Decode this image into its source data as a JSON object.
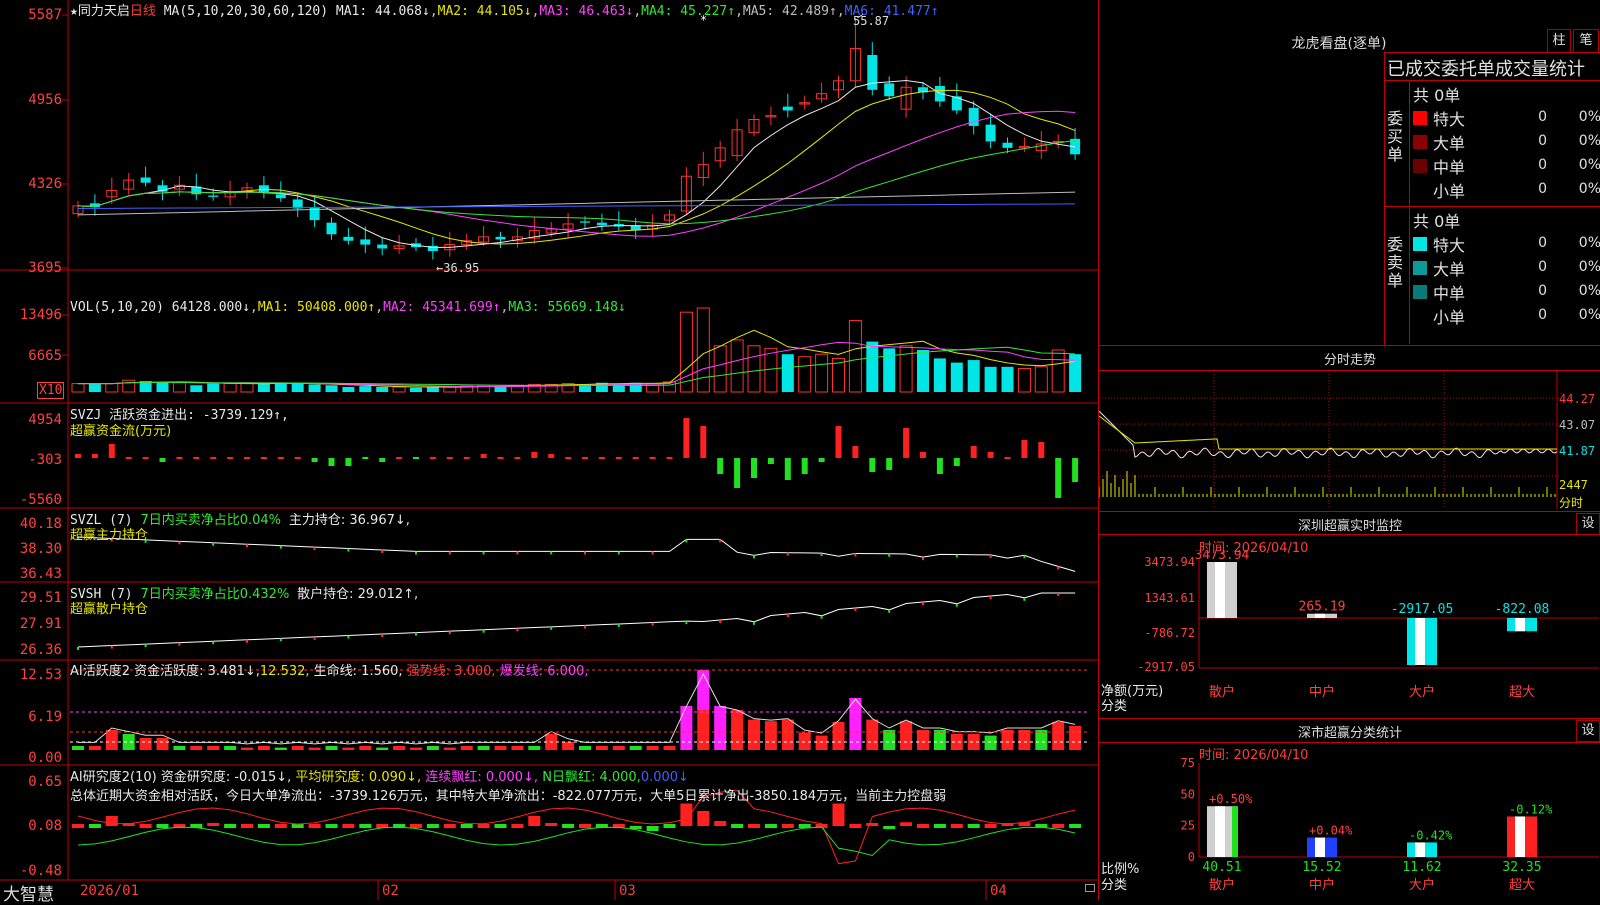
{
  "main": {
    "star": "★",
    "stock_name": "同力天启",
    "period": "日线",
    "ma_label": "MA(5,10,20,30,60,120)",
    "ma": [
      {
        "label": "MA1: 44.068↓",
        "color": "#e8e8e8"
      },
      {
        "label": "MA2: 44.105↓",
        "color": "#e6e600"
      },
      {
        "label": "MA3: 46.463↓",
        "color": "#ff40ff"
      },
      {
        "label": "MA4: 45.227↑",
        "color": "#35e635"
      },
      {
        "label": "MA5: 42.489↑",
        "color": "#bdbdbd"
      },
      {
        "label": "MA6: 41.477↑",
        "color": "#4060ff"
      }
    ],
    "y_ticks": [
      "5587",
      "4956",
      "4326",
      "3695"
    ],
    "high_note": "55.87",
    "low_note": "←36.95"
  },
  "vol": {
    "label": "VOL(5,10,20)",
    "value": "64128.000↓",
    "ma1": "MA1: 50408.000↑",
    "ma2": "MA2: 45341.699↑",
    "ma3": "MA3: 55669.148↓",
    "y_ticks": [
      "13496",
      "6665"
    ],
    "unit": "X10"
  },
  "svzj": {
    "label": "SVZJ  活跃资金进出: -3739.129↑,",
    "sub": "超赢资金流(万元)",
    "y_ticks": [
      "4954",
      "-303",
      "-5560"
    ]
  },
  "svzl": {
    "label": "SVZL (7)",
    "pct": "7日内买卖净占比0.04%",
    "main": "主力持仓: 36.967↓,",
    "sub": "超赢主力持仓",
    "y_ticks": [
      "40.18",
      "38.30",
      "36.43"
    ]
  },
  "svsh": {
    "label": "SVSH (7)",
    "pct": "7日内买卖净占比0.432%",
    "main": "散户持仓: 29.012↑,",
    "sub": "超赢散户持仓",
    "y_ticks": [
      "29.51",
      "27.91",
      "26.36"
    ]
  },
  "ai1": {
    "label": "AI活跃度2 资金活跃度: 3.481↓,",
    "v2": "12.532,",
    "v3": "生命线: 1.560,",
    "v4": "强势线: 3.000,",
    "v5": "爆发线: 6.000,",
    "y_ticks": [
      "12.53",
      "6.19",
      "0.00"
    ]
  },
  "ai2": {
    "label": "AI研究度2(10) 资金研究度: -0.015↓,",
    "v2": "平均研究度: 0.090↓,",
    "v3": "连续飘红: 0.000↓,",
    "v4": "N日飘红: 4.000,",
    "v5": "0.000↓",
    "summary": "总体近期大资金相对活跃，今日大单净流出：-3739.126万元，其中特大单净流出：-822.077万元，大单5日累计净出-3850.184万元，当前主力控盘弱",
    "y_ticks": [
      "0.65",
      "0.08",
      "-0.48"
    ]
  },
  "xaxis": {
    "brand": "大智慧",
    "labels": [
      "2026/01",
      "02",
      "03",
      "04"
    ]
  },
  "lhb": {
    "title": "龙虎看盘(逐单)",
    "btn1": "柱",
    "btn2": "笔",
    "header": "已成交委托单成交量统计",
    "buy": {
      "side": "委买单",
      "total": "共 0单",
      "rows": [
        {
          "name": "特大",
          "v": "0",
          "p": "0%",
          "c": "#ff0000"
        },
        {
          "name": "大单",
          "v": "0",
          "p": "0%",
          "c": "#8b0000"
        },
        {
          "name": "中单",
          "v": "0",
          "p": "0%",
          "c": "#6b0000"
        },
        {
          "name": "小单",
          "v": "0",
          "p": "0%",
          "c": "#000000"
        }
      ]
    },
    "sell": {
      "side": "委卖单",
      "total": "共 0单",
      "rows": [
        {
          "name": "特大",
          "v": "0",
          "p": "0%",
          "c": "#00e5e5"
        },
        {
          "name": "大单",
          "v": "0",
          "p": "0%",
          "c": "#0a9a9a"
        },
        {
          "name": "中单",
          "v": "0",
          "p": "0%",
          "c": "#087a7a"
        },
        {
          "name": "小单",
          "v": "0",
          "p": "0%",
          "c": "#000000"
        }
      ]
    }
  },
  "fs": {
    "title": "分时走势",
    "y_ticks": [
      "44.27",
      "43.07",
      "41.87"
    ],
    "vol_tick": "2447",
    "vol_unit": "分时"
  },
  "szjk": {
    "title": "深圳超赢实时监控",
    "btn": "设",
    "time": "时间: 2026/04/10",
    "y_ticks": [
      "3473.94",
      "1343.61",
      "-786.72",
      "-2917.05"
    ],
    "unit": "净额(万元)",
    "cls": "分类",
    "bars": [
      {
        "name": "散户",
        "value": "3473.94"
      },
      {
        "name": "中户",
        "value": "265.19"
      },
      {
        "name": "大户",
        "value": "-2917.05"
      },
      {
        "name": "超大",
        "value": "-822.08"
      }
    ]
  },
  "szfl": {
    "title": "深市超赢分类统计",
    "btn": "设",
    "time": "时间: 2026/04/10",
    "y_ticks": [
      "75",
      "50",
      "25",
      "0"
    ],
    "unit": "比例%",
    "cls": "分类",
    "bars": [
      {
        "name": "散户",
        "pct": "40.51",
        "chg": "+0.50%"
      },
      {
        "name": "中户",
        "pct": "15.52",
        "chg": "+0.04%"
      },
      {
        "name": "大户",
        "pct": "11.62",
        "chg": "-0.42%"
      },
      {
        "name": "超大",
        "pct": "32.35",
        "chg": "-0.12%"
      }
    ]
  }
}
